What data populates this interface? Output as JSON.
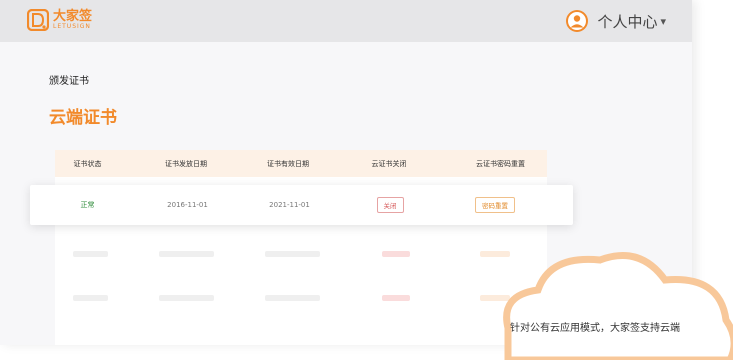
{
  "header": {
    "logo_name": "大家签",
    "logo_sub": "LETUSIGN",
    "user_label": "个人中心",
    "caret": "▾"
  },
  "breadcrumb": "颁发证书",
  "page_title": "云端证书",
  "table": {
    "columns": [
      "证书状态",
      "证书发放日期",
      "证书有效日期",
      "云证书关闭",
      "云证书密码重置"
    ],
    "row": {
      "status": "正常",
      "issue_date": "2016-11-01",
      "valid_date": "2021-11-01",
      "close_label": "关闭",
      "reset_label": "密码重置"
    }
  },
  "callout": {
    "text": "针对公有云应用模式，大家签支持云端"
  },
  "colors": {
    "brand": "#f28a2b",
    "status_ok": "#2e8b3a",
    "danger": "#d65a5a"
  }
}
